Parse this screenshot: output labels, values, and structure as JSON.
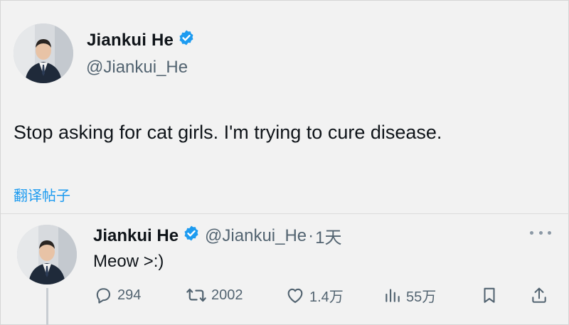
{
  "main_tweet": {
    "author_name": "Jiankui He",
    "handle": "@Jiankui_He",
    "text": "Stop asking for cat girls. I'm trying to cure disease.",
    "translate_label": "翻译帖子",
    "verified_color": "#1d9bf0"
  },
  "reply": {
    "author_name": "Jiankui He",
    "handle": "@Jiankui_He",
    "separator": "·",
    "time": "1天",
    "text": "Meow >:)",
    "actions": {
      "replies": "294",
      "retweets": "2002",
      "likes": "1.4万",
      "views": "55万"
    }
  },
  "icons": [
    "verified-badge-icon",
    "more-icon",
    "reply-icon",
    "retweet-icon",
    "like-icon",
    "views-icon",
    "bookmark-icon",
    "share-icon"
  ],
  "colors": {
    "link": "#1d9bf0",
    "secondary_text": "#536471",
    "background": "#f2f2f2"
  }
}
